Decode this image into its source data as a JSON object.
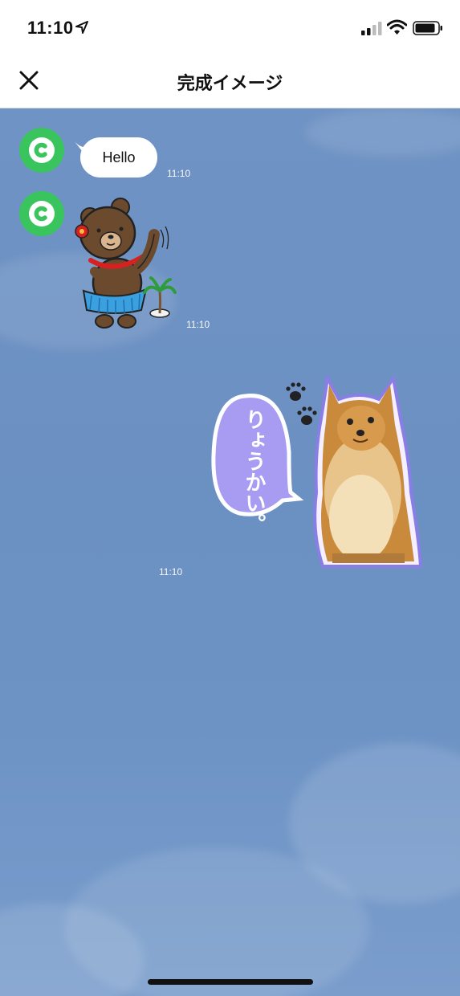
{
  "status_bar": {
    "time": "11:10"
  },
  "header": {
    "title": "完成イメージ"
  },
  "chat": {
    "messages": [
      {
        "type": "text",
        "text": "Hello",
        "time": "11:10"
      },
      {
        "type": "sticker",
        "sticker": "bear-hula-sticker",
        "time": "11:10"
      },
      {
        "type": "sticker",
        "sticker": "pomeranian-ryoukai-sticker",
        "caption": "りょうかい。",
        "time": "11:10"
      }
    ]
  },
  "colors": {
    "avatar": "#3ac45e",
    "chat_background": "#6f93c4",
    "sticker_bubble": "#a89bf2"
  }
}
